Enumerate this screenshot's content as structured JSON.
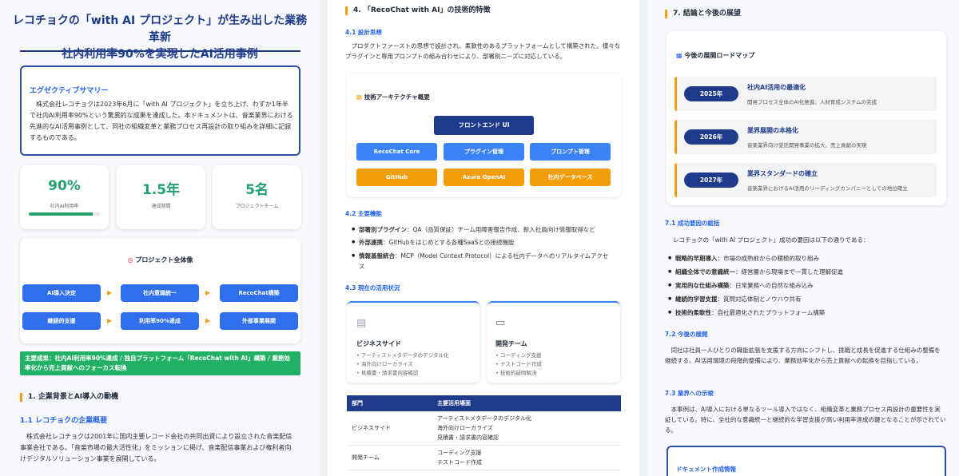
{
  "col1": {
    "title_line1": "レコチョクの「with AI プロジェクト」が生み出した業務革新",
    "title_line2": "社内利用率90%を実現したAI活用事例",
    "summary": {
      "heading": "エグゼクティブサマリー",
      "text": "株式会社レコチョクは2023年6月に「with AI プロジェクト」を立ち上げ、わずか1年半で社内AI利用率90%という驚異的な成果を達成した。本ドキュメントは、音楽業界における先進的なAI活用事例として、同社の組織変革と業務プロセス再設計の取り組みを詳細に記録するものである。"
    },
    "kpis": [
      {
        "value": "90%",
        "label": "社内AI利用率",
        "progress": 0.9
      },
      {
        "value": "1.5年",
        "label": "達成期間"
      },
      {
        "value": "5名",
        "label": "プロジェクトチーム"
      }
    ],
    "overview": {
      "heading": "プロジェクト全体像",
      "steps_row1": [
        "AI導入決定",
        "社内意識統一",
        "RecoChat構築"
      ],
      "steps_row2": [
        "継続的支援",
        "利用率90%達成",
        "外部事業展開"
      ],
      "arrow": "▶"
    },
    "result_band": "主要成果：社内AI利用率90%達成 / 独自プラットフォーム「RecoChat with AI」構築 / 業務効率化から売上貢献へのフォーカス転換",
    "section1": {
      "heading": "1. 企業背景とAI導入の動機",
      "sub": "1.1 レコチョクの企業概要",
      "text": "株式会社レコチョクは2001年に国内主要レコード会社の共同出資により設立された音楽配信事業会社である。「音楽市場の最大活性化」をミッションに掲げ、音楽配信事業および権利者向けデジタルソリューション事業を展開している。"
    }
  },
  "col2": {
    "heading": "4. 「RecoChat with AI」の技術的特徴",
    "s41": {
      "sub": "4.1 設計思想",
      "text": "プロダクトファーストの思想で設計され、柔軟性のあるプラットフォームとして構築された。様々なプラグインと専用プロンプトの組み合わせにより、部署別ニーズに対応している。"
    },
    "arch": {
      "heading": "技術アーキテクチャ概要",
      "top": "フロントエンド UI",
      "mid": [
        "RecoChat Core",
        "プラグイン管理",
        "プロンプト管理"
      ],
      "bottom": [
        "GitHub",
        "Azure OpenAI",
        "社内データベース"
      ]
    },
    "s42": {
      "sub": "4.2 主要機能",
      "items": [
        {
          "bold": "部署別プラグイン",
          "text": "：QA（品質保証）チーム用障害報告作成、新入社員向け情報取得など"
        },
        {
          "bold": "外部連携",
          "text": "：GitHubをはじめとする各種SaaSとの接続機能"
        },
        {
          "bold": "情報基盤統合",
          "text": "：MCP（Model Context Protocol）による社内データへのリアルタイムアクセス"
        }
      ]
    },
    "s43": {
      "sub": "4.3 現在の活用状況",
      "cards": [
        {
          "title": "ビジネスサイド",
          "items": [
            "アーティストメタデータのデジタル化",
            "海外向けローカライズ",
            "見積書・請求書内容確認"
          ]
        },
        {
          "title": "開発チーム",
          "items": [
            "コーディング支援",
            "テストコード作成",
            "技術的疑問解決"
          ]
        }
      ]
    },
    "table": {
      "headers": [
        "部門",
        "主要活用場面"
      ],
      "rows": [
        {
          "dept": "ビジネスサイド",
          "uses": [
            "アーティストメタデータのデジタル化",
            "海外向けローカライズ",
            "見積書・請求書内容確認"
          ]
        },
        {
          "dept": "開発チーム",
          "uses": [
            "コーディング支援",
            "テストコード作成"
          ]
        }
      ]
    }
  },
  "col3": {
    "heading": "7. 結論と今後の展望",
    "roadmap": {
      "heading": "今後の展開ロードマップ",
      "rows": [
        {
          "year": "2025年",
          "title": "社内AI活用の最適化",
          "desc": "開発プロセス全体のAI化推進、人材育成システムの完成"
        },
        {
          "year": "2026年",
          "title": "業界展開の本格化",
          "desc": "音楽業界向け受託開発事業の拡大、売上貢献の実現"
        },
        {
          "year": "2027年",
          "title": "業界スタンダードの確立",
          "desc": "音楽業界におけるAI活用のリーディングカンパニーとしての地位確立"
        }
      ]
    },
    "s71": {
      "sub": "7.1 成功要因の総括",
      "intro": "レコチョクの「with AI プロジェクト」成功の要因は以下の通りである：",
      "items": [
        {
          "bold": "戦略的早期導入",
          "text": "：市場の成熟前からの積極的取り組み"
        },
        {
          "bold": "組織全体での意識統一",
          "text": "：経営層から現場まで一貫した理解促進"
        },
        {
          "bold": "実用的な仕組み構築",
          "text": "：日常業務への自然な組み込み"
        },
        {
          "bold": "継続的学習支援",
          "text": "：質問対応体制とノウハウ共有"
        },
        {
          "bold": "技術的柔軟性",
          "text": "：自社最適化されたプラットフォーム構築"
        }
      ]
    },
    "s72": {
      "sub": "7.2 今後の展開",
      "text": "同社は社員一人ひとりの職能拡張を支援する方向にシフトし、挑戦と成長を促進する仕組みの整備を継続する。AI活用環境の段階的整備により、業務効率化から売上貢献への転換を目指している。"
    },
    "s73": {
      "sub": "7.3 業界への示唆",
      "text": "本事例は、AI導入における単なるツール導入ではなく、組織変革と業務プロセス再設計の重要性を実証している。特に、全社的な意識統一と継続的な学習支援が高い利用率達成の鍵となることが示されている。"
    },
    "docinfo": {
      "heading": "ドキュメント作成情報"
    }
  },
  "colors": {
    "navy": "#1e3a8a",
    "blue": "#3b82f6",
    "orange": "#f59e0b",
    "green": "#22b065"
  }
}
